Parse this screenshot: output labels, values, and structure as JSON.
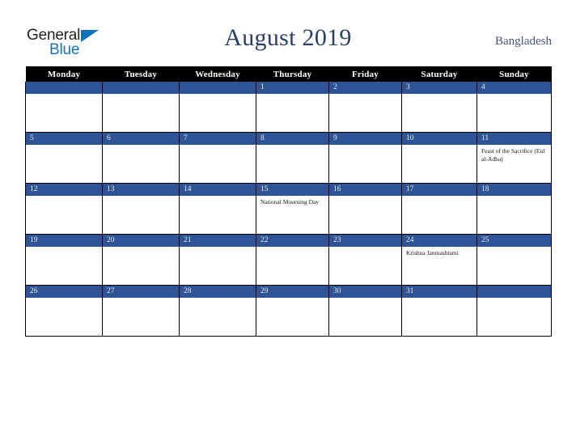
{
  "brand": {
    "name_part1": "General",
    "name_part2": "Blue",
    "triangle_color": "#1273ba",
    "text_color": "#231f20"
  },
  "header": {
    "title": "August 2019",
    "country": "Bangladesh",
    "title_color": "#2b3f63"
  },
  "calendar": {
    "accent_color": "#2f5496",
    "header_bg": "#000000",
    "weekdays": [
      "Monday",
      "Tuesday",
      "Wednesday",
      "Thursday",
      "Friday",
      "Saturday",
      "Sunday"
    ],
    "weeks": [
      [
        {
          "day": "",
          "event": ""
        },
        {
          "day": "",
          "event": ""
        },
        {
          "day": "",
          "event": ""
        },
        {
          "day": "1",
          "event": ""
        },
        {
          "day": "2",
          "event": ""
        },
        {
          "day": "3",
          "event": ""
        },
        {
          "day": "4",
          "event": ""
        }
      ],
      [
        {
          "day": "5",
          "event": ""
        },
        {
          "day": "6",
          "event": ""
        },
        {
          "day": "7",
          "event": ""
        },
        {
          "day": "8",
          "event": ""
        },
        {
          "day": "9",
          "event": ""
        },
        {
          "day": "10",
          "event": ""
        },
        {
          "day": "11",
          "event": "Feast of the Sacrifice (Eid al-Adha)"
        }
      ],
      [
        {
          "day": "12",
          "event": ""
        },
        {
          "day": "13",
          "event": ""
        },
        {
          "day": "14",
          "event": ""
        },
        {
          "day": "15",
          "event": "National Mourning Day"
        },
        {
          "day": "16",
          "event": ""
        },
        {
          "day": "17",
          "event": ""
        },
        {
          "day": "18",
          "event": ""
        }
      ],
      [
        {
          "day": "19",
          "event": ""
        },
        {
          "day": "20",
          "event": ""
        },
        {
          "day": "21",
          "event": ""
        },
        {
          "day": "22",
          "event": ""
        },
        {
          "day": "23",
          "event": ""
        },
        {
          "day": "24",
          "event": "Krishna Janmashtami"
        },
        {
          "day": "25",
          "event": ""
        }
      ],
      [
        {
          "day": "26",
          "event": ""
        },
        {
          "day": "27",
          "event": ""
        },
        {
          "day": "28",
          "event": ""
        },
        {
          "day": "29",
          "event": ""
        },
        {
          "day": "30",
          "event": ""
        },
        {
          "day": "31",
          "event": ""
        },
        {
          "day": "",
          "event": ""
        }
      ]
    ]
  }
}
